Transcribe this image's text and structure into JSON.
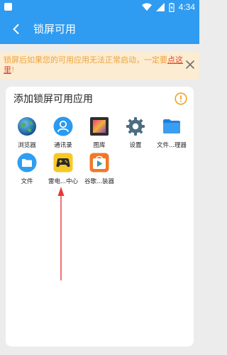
{
  "status_bar": {
    "time": "4:34"
  },
  "app_bar": {
    "title": "锁屏可用",
    "back_icon": "arrow-left-icon"
  },
  "warning": {
    "text": "锁屏后如果您的可用应用无法正常启动，一定要",
    "link": "点这里",
    "suffix": "!"
  },
  "card": {
    "title": "添加锁屏可用应用",
    "apps": [
      {
        "label": "浏览器",
        "icon": "globe-icon"
      },
      {
        "label": "通讯录",
        "icon": "contacts-icon"
      },
      {
        "label": "图库",
        "icon": "gallery-icon"
      },
      {
        "label": "设置",
        "icon": "gear-icon"
      },
      {
        "label": "文件...理器",
        "icon": "folder-icon"
      },
      {
        "label": "文件",
        "icon": "folder-icon"
      },
      {
        "label": "雷电...中心",
        "icon": "gamepad-icon"
      },
      {
        "label": "谷歌...装器",
        "icon": "store-bag-icon"
      }
    ]
  },
  "colors": {
    "primary": "#2f9bf1",
    "warning_bg": "#fbecd2",
    "warning_text": "#f0a33d",
    "link": "#e2452a",
    "annotation_arrow": "#e53935"
  }
}
